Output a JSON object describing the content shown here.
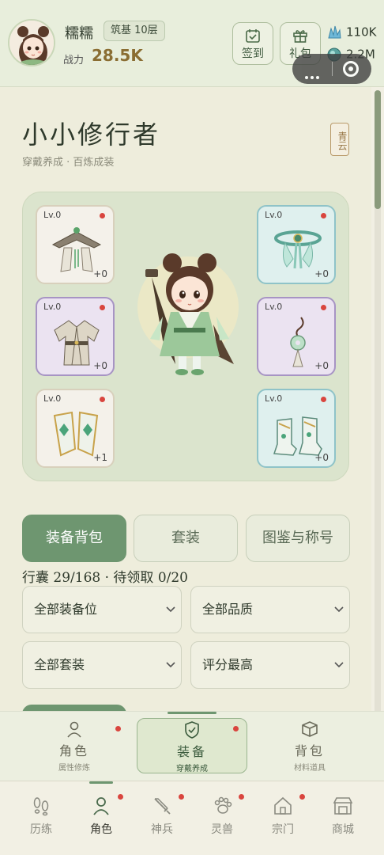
{
  "header": {
    "player_name": "糯糯",
    "realm_badge": "筑基 10层",
    "power_label": "战力",
    "power_value": "28.5K",
    "checkin_label": "签到",
    "gift_label": "礼包",
    "resource1": "110K",
    "resource2": "2.2M"
  },
  "page": {
    "title": "小小修行者",
    "subtitle": "穿戴养成 · 百炼成装",
    "seal": "青云"
  },
  "slots": [
    {
      "level": "Lv.0",
      "plus": "+0",
      "item": "hat-icon"
    },
    {
      "level": "Lv.0",
      "plus": "+0",
      "item": "belt-icon"
    },
    {
      "level": "Lv.0",
      "plus": "+0",
      "item": "robe-icon"
    },
    {
      "level": "Lv.0",
      "plus": "+0",
      "item": "pendant-icon"
    },
    {
      "level": "Lv.0",
      "plus": "+1",
      "item": "bracer-icon"
    },
    {
      "level": "Lv.0",
      "plus": "+0",
      "item": "boots-icon"
    }
  ],
  "tabs": [
    "装备背包",
    "套装",
    "图鉴与称号"
  ],
  "bag_status": "行囊 29/168 · 待领取 0/20",
  "filters": [
    "全部装备位",
    "全部品质",
    "全部套装",
    "评分最高"
  ],
  "subnav": [
    {
      "l1": "角色",
      "l2": "属性修炼"
    },
    {
      "l1": "装备",
      "l2": "穿戴养成"
    },
    {
      "l1": "背包",
      "l2": "材料道具"
    }
  ],
  "bottomnav": [
    "历练",
    "角色",
    "神兵",
    "灵兽",
    "宗门",
    "商城"
  ],
  "colors": {
    "accent": "#6e9670",
    "badge": "#d9453e",
    "power": "#8a6d32"
  }
}
